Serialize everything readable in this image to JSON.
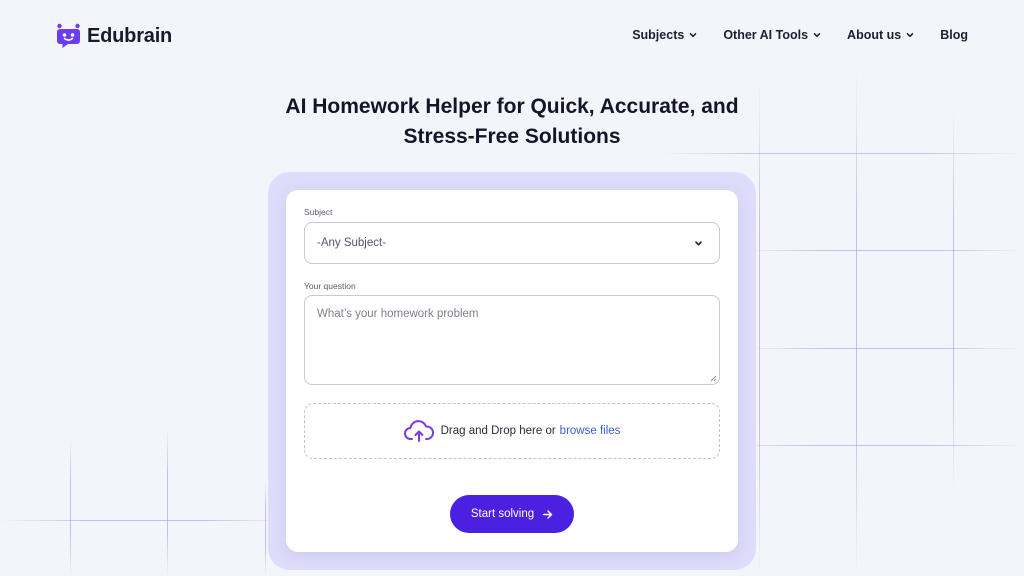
{
  "brand": {
    "name": "Edubrain",
    "accent": "#6b3cf0",
    "logo_icon": "robot-chat-logo-icon"
  },
  "nav": {
    "items": [
      {
        "label": "Subjects",
        "dropdown": true
      },
      {
        "label": "Other AI Tools",
        "dropdown": true
      },
      {
        "label": "About us",
        "dropdown": true
      },
      {
        "label": "Blog",
        "dropdown": false
      }
    ]
  },
  "hero": {
    "title_line1": "AI Homework Helper for Quick, Accurate, and",
    "title_line2": "Stress-Free Solutions"
  },
  "form": {
    "subject_label": "Subject",
    "subject_value": "-Any Subject-",
    "question_label": "Your question",
    "question_placeholder": "What’s your homework problem",
    "dropzone_text": "Drag and Drop here or",
    "dropzone_link": "browse files",
    "submit_label": "Start solving",
    "button_color": "#4b20e0",
    "link_color": "#3b5bdb"
  }
}
